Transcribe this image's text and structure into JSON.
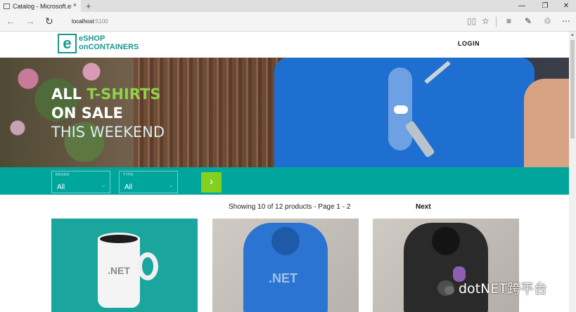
{
  "browser": {
    "tab_title": "Catalog - Microsoft.eSh",
    "tab_close": "×",
    "new_tab": "+",
    "window_minimize": "—",
    "window_restore": "❐",
    "window_close": "✕",
    "url_host": "localhost",
    "url_port": ":5100",
    "icons": [
      "back-icon",
      "forward-icon",
      "refresh-icon",
      "reading-view-icon",
      "favorite-star-icon",
      "hub-icon",
      "web-note-icon",
      "share-icon",
      "more-icon"
    ]
  },
  "header": {
    "logo_letter": "e",
    "logo_line1": "eSHOP",
    "logo_line2": "onCONTAINERS",
    "login": "LOGIN",
    "brand_color": "#19978f"
  },
  "hero": {
    "line1_white": "ALL ",
    "line1_green": "T-SHIRTS",
    "line2": "ON SALE",
    "line3": "THIS WEEKEND",
    "accent": "#8fd24a"
  },
  "filters": {
    "brand_label": "BRAND",
    "brand_value": "All",
    "type_label": "TYPE",
    "type_value": "All",
    "go_symbol": "›",
    "bar_color": "#00a69c"
  },
  "pager": {
    "showing": "Showing 10 of 12 products - Page 1 - 2",
    "next": "Next"
  },
  "products": [
    {
      "image_text": ".NET",
      "kind": "mug"
    },
    {
      "image_text": ".NET",
      "kind": "blue-hoodie"
    },
    {
      "image_text": "",
      "kind": "black-hoodie"
    }
  ],
  "watermark": {
    "text": "dotNET跨平台"
  }
}
